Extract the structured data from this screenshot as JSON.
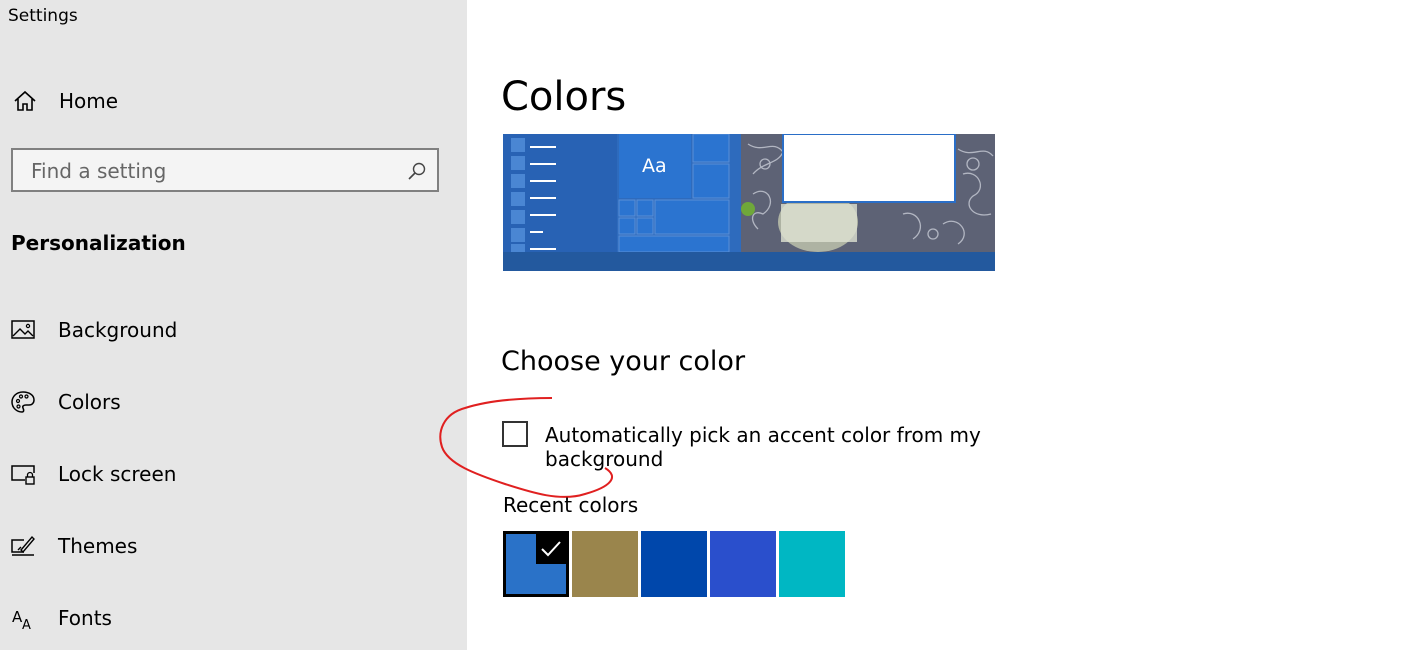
{
  "window": {
    "title": "Settings"
  },
  "sidebar": {
    "home_label": "Home",
    "search": {
      "placeholder": "Find a setting",
      "value": ""
    },
    "section_title": "Personalization",
    "items": [
      {
        "label": "Background",
        "icon": "image-icon"
      },
      {
        "label": "Colors",
        "icon": "palette-icon"
      },
      {
        "label": "Lock screen",
        "icon": "lock-screen-icon"
      },
      {
        "label": "Themes",
        "icon": "brush-icon"
      },
      {
        "label": "Fonts",
        "icon": "font-icon"
      }
    ]
  },
  "main": {
    "title": "Colors",
    "preview": {
      "sample_text": "Aa",
      "accent": "#2a6ec7"
    },
    "choose_heading": "Choose your color",
    "auto_pick": {
      "label": "Automatically pick an accent color from my background",
      "checked": false
    },
    "recent_label": "Recent colors",
    "recent_colors": [
      {
        "color": "#2a72c8",
        "selected": true
      },
      {
        "color": "#9a854c",
        "selected": false
      },
      {
        "color": "#0047ab",
        "selected": false
      },
      {
        "color": "#2a4fcc",
        "selected": false
      },
      {
        "color": "#00b7c3",
        "selected": false
      }
    ],
    "annotation_color": "#e02020"
  }
}
